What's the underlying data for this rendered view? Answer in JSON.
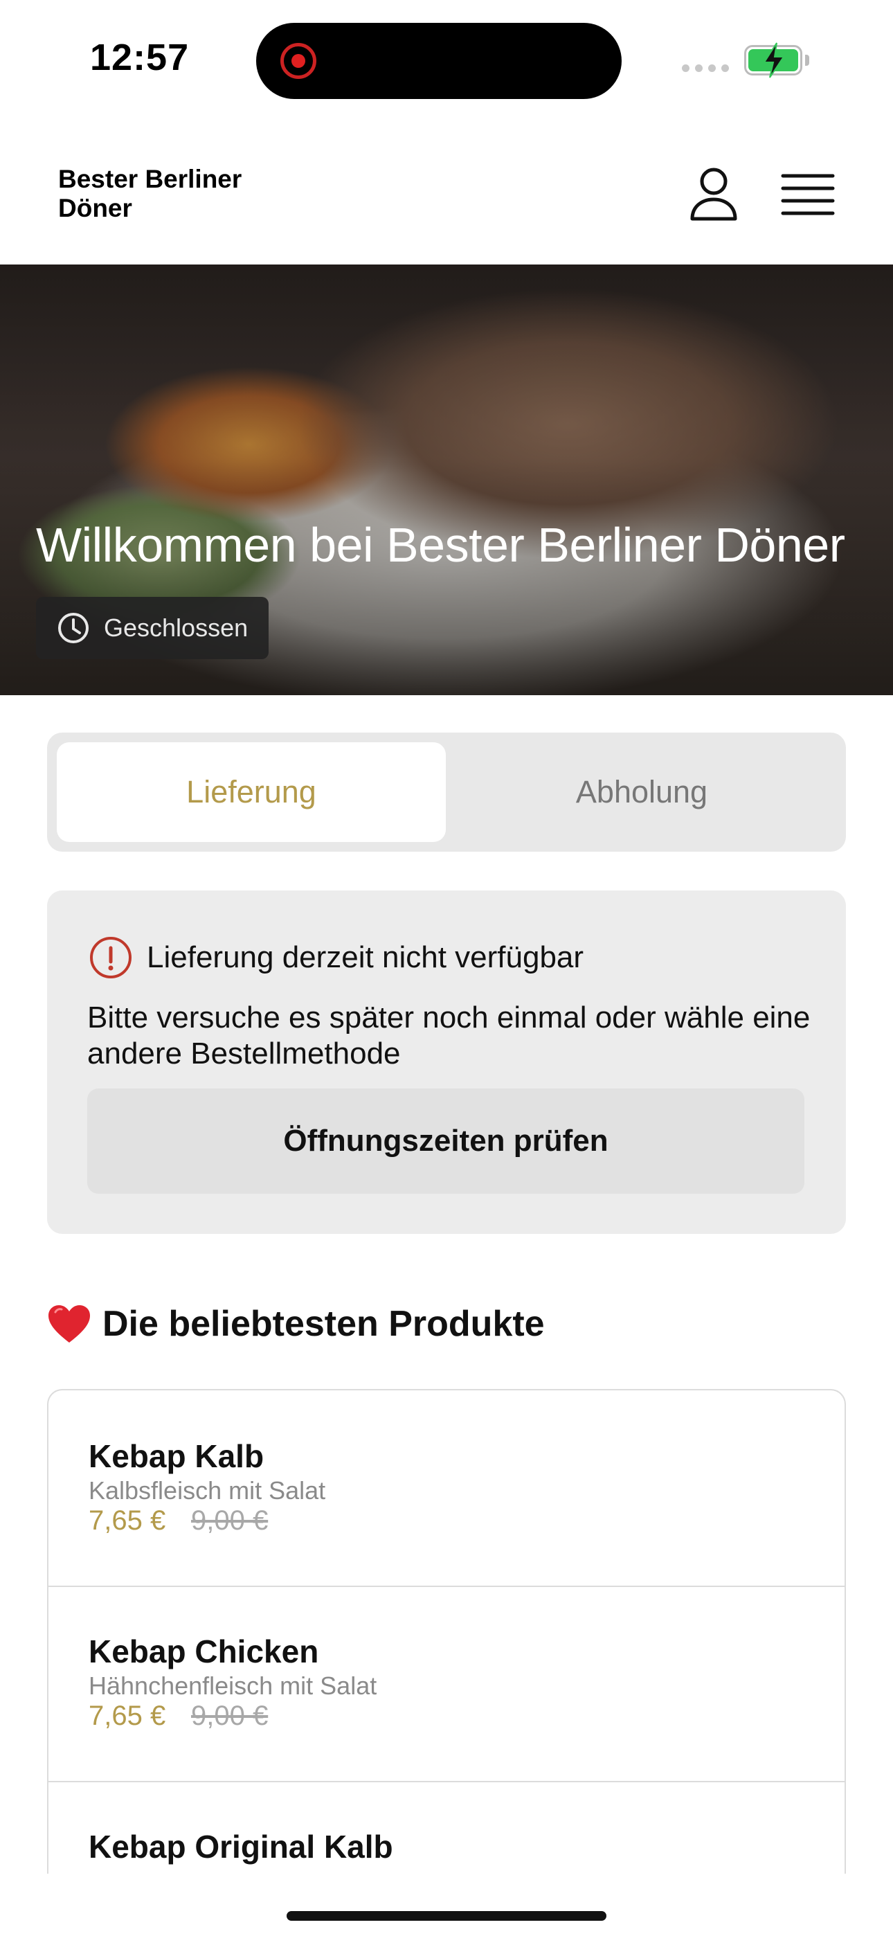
{
  "status_bar": {
    "time": "12:57"
  },
  "header": {
    "brand": "Bester Berliner Döner",
    "account_icon": "person-icon",
    "menu_icon": "hamburger-menu-icon"
  },
  "hero": {
    "title": "Willkommen bei Bester Berliner Döner",
    "status": "Geschlossen",
    "status_icon": "clock-icon"
  },
  "tabs": [
    {
      "label": "Lieferung",
      "active": true
    },
    {
      "label": "Abholung",
      "active": false
    }
  ],
  "notice": {
    "icon": "info-circle-icon",
    "title": "Lieferung derzeit nicht verfügbar",
    "body": "Bitte versuche es später noch einmal oder wähle eine andere Bestellmethode",
    "button": "Öffnungszeiten prüfen"
  },
  "popular": {
    "icon": "heart-icon",
    "title": "Die beliebtesten Produkte",
    "products": [
      {
        "name": "Kebap Kalb",
        "description": "Kalbsfleisch mit Salat",
        "price": "7,65 €",
        "old_price": "9,00 €"
      },
      {
        "name": "Kebap Chicken",
        "description": "Hähnchenfleisch mit Salat",
        "price": "7,65 €",
        "old_price": "9,00 €"
      },
      {
        "name": "Kebap Original Kalb",
        "description": "",
        "price": "",
        "old_price": ""
      }
    ]
  },
  "colors": {
    "accent": "#b39a4b",
    "status_chip": "#232323",
    "notice_bg": "#ececec",
    "battery": "#34c759"
  }
}
